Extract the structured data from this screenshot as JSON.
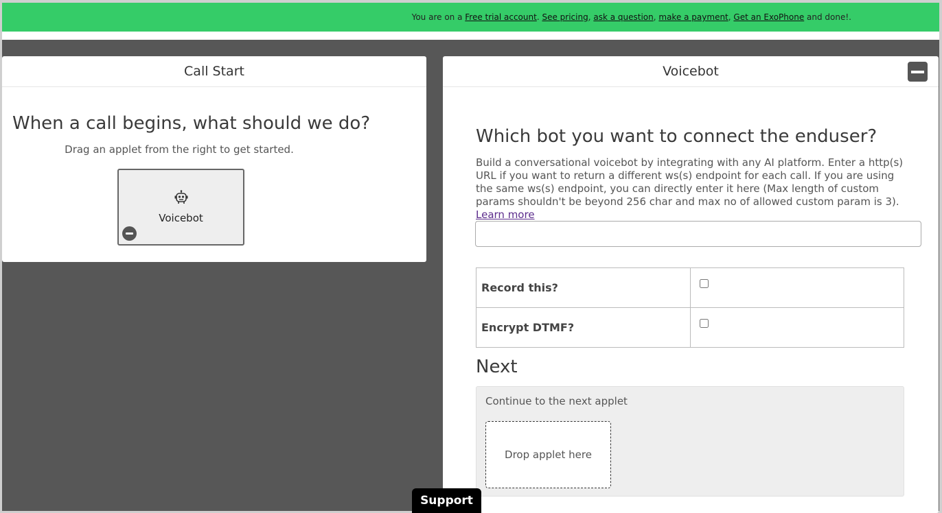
{
  "banner": {
    "prefix": "You are on a ",
    "free_trial": "Free trial account",
    "sep1": ". ",
    "see_pricing": "See pricing",
    "sep2": ", ",
    "ask_question": "ask a question",
    "sep3": ", ",
    "make_payment": "make a payment",
    "sep4": ", ",
    "get_exophone": "Get an ExoPhone",
    "suffix": " and done!."
  },
  "call_start": {
    "title": "Call Start",
    "heading": "When a call begins, what should we do?",
    "hint": "Drag an applet from the right to get started.",
    "applet": {
      "icon": "robot-icon",
      "label": "Voicebot"
    }
  },
  "voicebot": {
    "title": "Voicebot",
    "question": "Which bot you want to connect the enduser?",
    "description": "Build a conversational voicebot by integrating with any AI platform. Enter a http(s) URL if you want to return a different ws(s) endpoint for each call. If you are using the same ws(s) endpoint, you can directly enter it here (Max length of custom params shouldn't be beyond 256 char and max no of allowed custom param is 3).",
    "learn_more": "Learn more",
    "url_value": "",
    "options": [
      {
        "label": "Record this?",
        "checked": false
      },
      {
        "label": "Encrypt DTMF?",
        "checked": false
      }
    ],
    "next_heading": "Next",
    "next_label": "Continue to the next applet",
    "drop_zone": "Drop applet here"
  },
  "support": {
    "label": "Support"
  }
}
